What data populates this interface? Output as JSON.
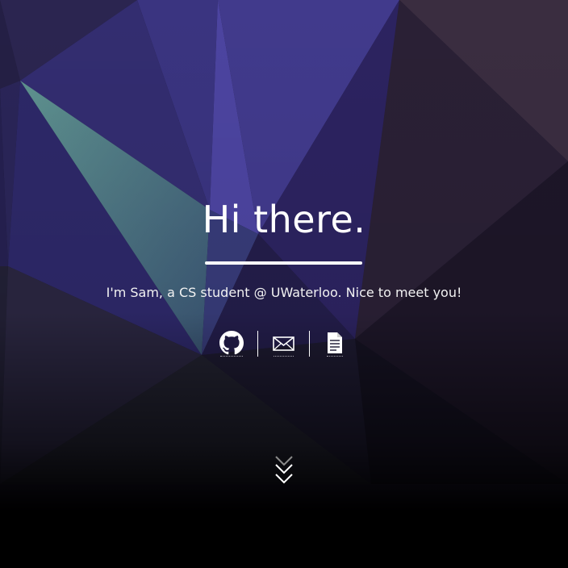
{
  "hero": {
    "title": "Hi there.",
    "subtitle": "I'm Sam, a CS student @ UWaterloo. Nice to meet you!"
  },
  "links": [
    {
      "name": "github",
      "icon": "github-icon"
    },
    {
      "name": "email",
      "icon": "envelope-icon"
    },
    {
      "name": "resume",
      "icon": "document-icon"
    }
  ],
  "scroll_icon": "double-chevron-down-icon",
  "colors": {
    "text": "#ffffff",
    "background_top": "#3b2f6b",
    "background_bottom": "#000000",
    "accent_teal": "#5e9e96"
  }
}
